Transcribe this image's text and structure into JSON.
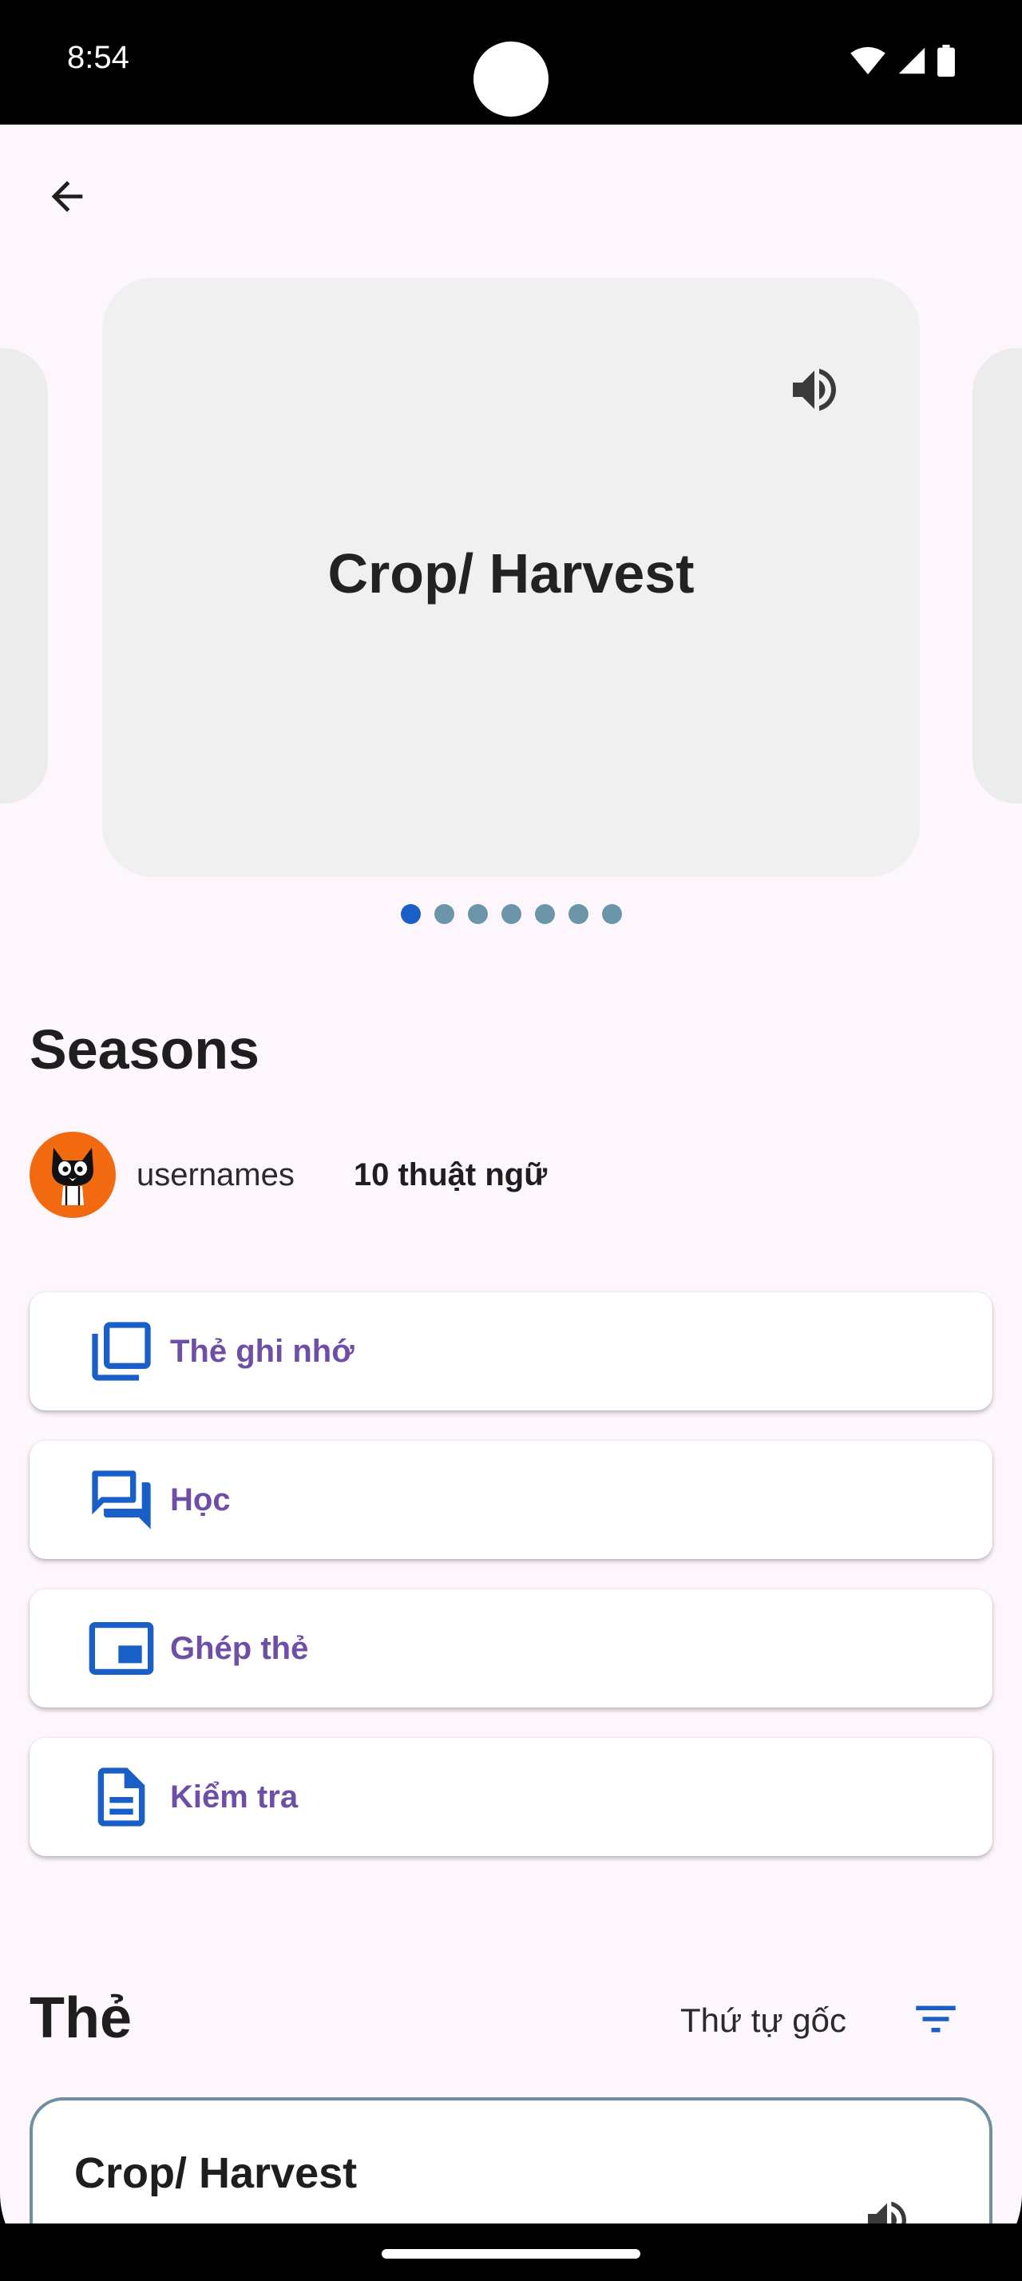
{
  "status": {
    "time": "8:54"
  },
  "carousel": {
    "term": "Crop/ Harvest",
    "page_count": 7,
    "active_index": 0
  },
  "set": {
    "title": "Seasons",
    "username": "usernames",
    "term_count": "10 thuật ngữ"
  },
  "modes": [
    {
      "label": "Thẻ ghi nhớ",
      "icon": "flashcards-icon"
    },
    {
      "label": "Học",
      "icon": "forum-icon"
    },
    {
      "label": "Ghép thẻ",
      "icon": "match-icon"
    },
    {
      "label": "Kiểm tra",
      "icon": "test-document-icon"
    }
  ],
  "cards_section": {
    "title": "Thẻ",
    "sort_label": "Thứ tự gốc",
    "first_card": "Crop/ Harvest"
  },
  "colors": {
    "accent": "#1a5fc7",
    "mode_label": "#6f4fa6",
    "background": "#fdf6fc",
    "avatar_bg": "#f26a10"
  }
}
